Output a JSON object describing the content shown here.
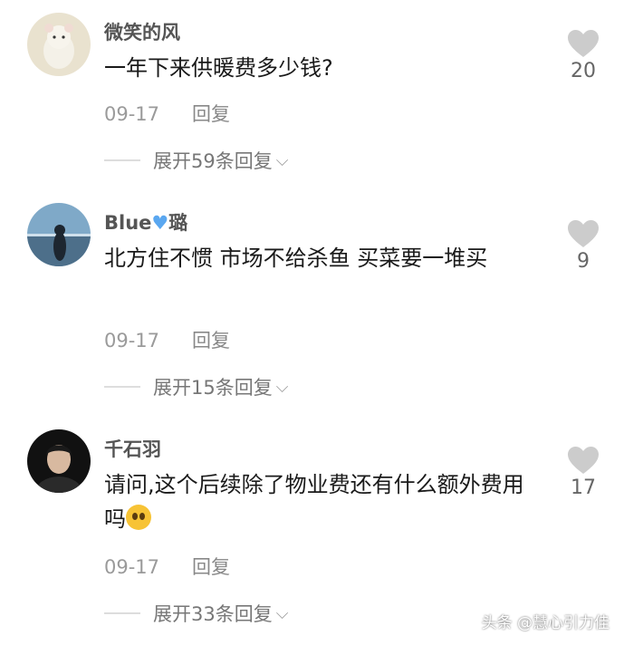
{
  "comments": [
    {
      "username": "微笑的风",
      "text": "一年下来供暖费多少钱?",
      "date": "09-17",
      "reply_label": "回复",
      "expand_label": "展开59条回复",
      "likes": "20",
      "avatar_desc": "cute-figure-avatar"
    },
    {
      "username": "Blue",
      "username_suffix": "璐",
      "text": "北方住不惯 市场不给杀鱼 买菜要一堆买",
      "date": "09-17",
      "reply_label": "回复",
      "expand_label": "展开15条回复",
      "likes": "9",
      "avatar_desc": "silhouette-by-sea-avatar"
    },
    {
      "username": "千石羽",
      "text": "请问,这个后续除了物业费还有什么额外费用吗",
      "date": "09-17",
      "reply_label": "回复",
      "expand_label": "展开33条回复",
      "likes": "17",
      "avatar_desc": "man-portrait-avatar"
    }
  ],
  "footer": "头条 @慧心引力佳",
  "colors": {
    "like_heart": "#cccccc",
    "blue_heart": "#5aa7f0"
  }
}
